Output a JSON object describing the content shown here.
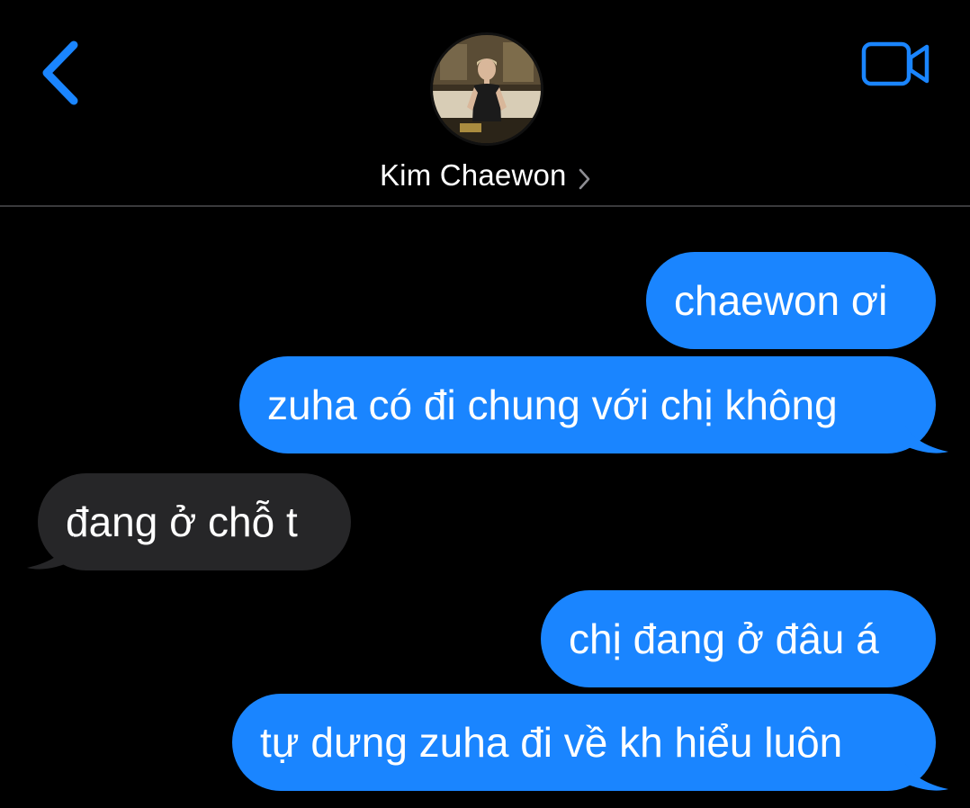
{
  "header": {
    "contact_name": "Kim Chaewon",
    "back_icon": "chevron-left-icon",
    "video_icon": "video-camera-icon",
    "avatar": "contact-avatar-photo",
    "accent_color": "#1a85ff"
  },
  "messages": [
    {
      "direction": "sent",
      "text": "chaewon ơi"
    },
    {
      "direction": "sent",
      "text": "zuha có đi chung với chị không"
    },
    {
      "direction": "received",
      "text": "đang ở chỗ t"
    },
    {
      "direction": "sent",
      "text": "chị đang ở đâu á"
    },
    {
      "direction": "sent",
      "text": "tự dưng zuha đi về kh hiểu luôn"
    }
  ],
  "colors": {
    "sent_bubble": "#1a85ff",
    "received_bubble": "#262628",
    "background": "#000000",
    "divider": "#3a3a3c"
  }
}
